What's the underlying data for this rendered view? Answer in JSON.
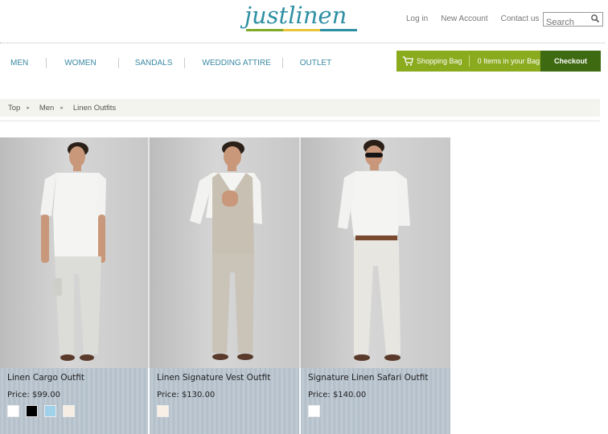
{
  "header": {
    "logo_text": "justlinen",
    "logo_colors": [
      "#7fa92a",
      "#e9c43a",
      "#2f8fa3"
    ],
    "links": [
      "Log in",
      "New Account",
      "Contact us"
    ],
    "search_placeholder": "Search"
  },
  "nav": {
    "items": [
      "MEN",
      "WOMEN",
      "SANDALS",
      "WEDDING ATTIRE",
      "OUTLET"
    ],
    "bag_label": "Shopping Bag",
    "bag_count": "0 Items in your Bag",
    "checkout": "Checkout",
    "colors": {
      "bag": "#8bab1f",
      "checkout": "#3e6a12",
      "nav_text": "#3b8aa4"
    }
  },
  "breadcrumb": [
    "Top",
    "Men",
    "Linen Outfits"
  ],
  "products": [
    {
      "name": "Linen Cargo Outfit",
      "price": "Price: $99.00",
      "swatches": [
        "#ffffff",
        "#000000",
        "#9fd2ea",
        "#f6eee4"
      ]
    },
    {
      "name": "Linen Signature Vest Outfit",
      "price": "Price: $130.00",
      "swatches": [
        "#f8efe6"
      ]
    },
    {
      "name": "Signature Linen Safari Outfit",
      "price": "Price: $140.00",
      "swatches": [
        "#ffffff"
      ]
    }
  ]
}
